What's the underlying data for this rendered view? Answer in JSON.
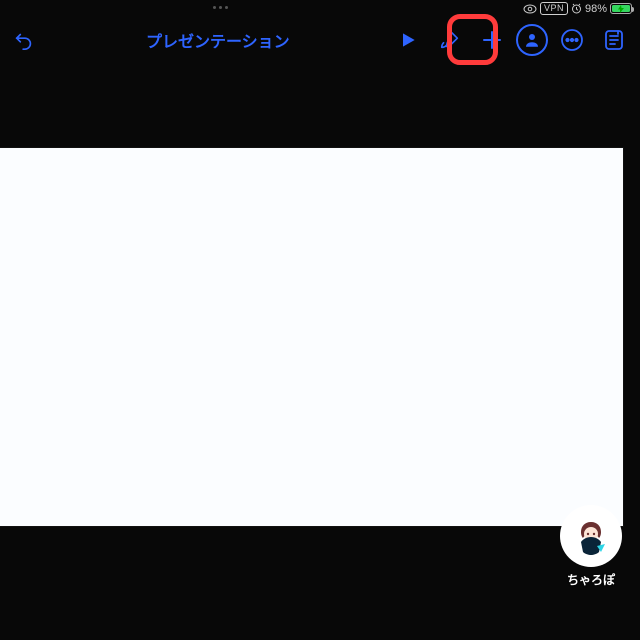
{
  "status": {
    "vpn": "VPN",
    "battery_pct": "98%"
  },
  "toolbar": {
    "title": "プレゼンテーション"
  },
  "user": {
    "name": "ちゃろぽ"
  },
  "colors": {
    "accent": "#2e64ff",
    "highlight": "#ff3b3b"
  }
}
